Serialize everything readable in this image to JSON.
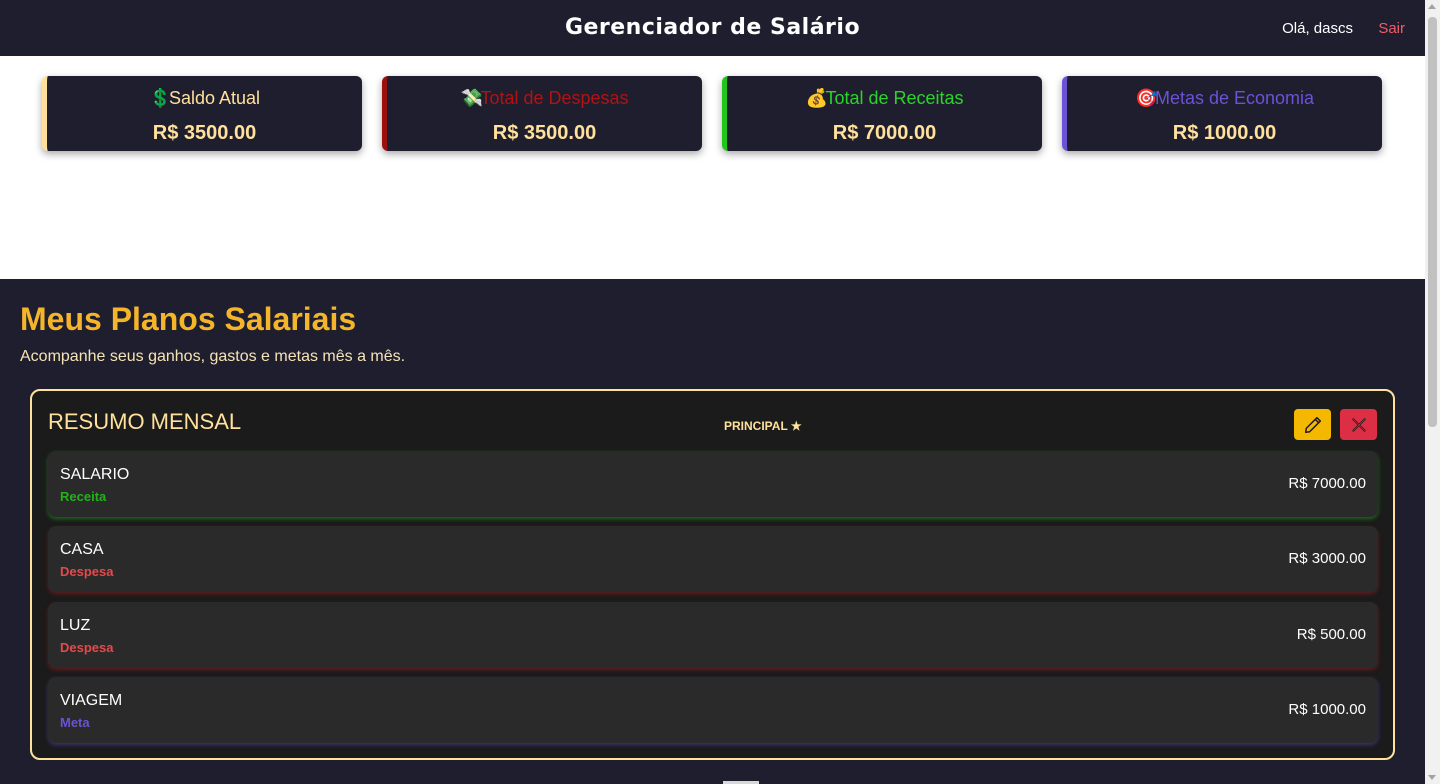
{
  "header": {
    "title": "Gerenciador de Salário",
    "greeting": "Olá, dascs",
    "logout_label": "Sair"
  },
  "summary_cards": [
    {
      "icon": "dollar-icon",
      "glyph": "💲",
      "label": "Saldo Atual",
      "value": "R$ 3500.00",
      "accent": "#ffe19c",
      "label_color": "#ffe19c"
    },
    {
      "icon": "money-with-wings-icon",
      "glyph": "💸",
      "label": "Total de Despesas",
      "value": "R$ 3500.00",
      "accent": "#9c0f0f",
      "label_color": "#b31212"
    },
    {
      "icon": "money-bag-icon",
      "glyph": "💰",
      "label": "Total de Receitas",
      "value": "R$ 7000.00",
      "accent": "#22c51a",
      "label_color": "#2bd42a"
    },
    {
      "icon": "target-icon",
      "glyph": "🎯",
      "label": "Metas de Economia",
      "value": "R$ 1000.00",
      "accent": "#6b52d6",
      "label_color": "#6b52d6"
    }
  ],
  "main": {
    "heading": "Meus Planos Salariais",
    "subtitle": "Acompanhe seus ganhos, gastos e metas mês a mês."
  },
  "plan": {
    "title": "RESUMO MENSAL",
    "badge": "PRINCIPAL ★",
    "edit_icon": "pencil-icon",
    "delete_icon": "close-icon",
    "items": [
      {
        "name": "SALARIO",
        "type": "Receita",
        "amount": "R$ 7000.00",
        "type_color": "#24b01b",
        "glow": "rgba(34,170,26,0.55)"
      },
      {
        "name": "CASA",
        "type": "Despesa",
        "amount": "R$ 3000.00",
        "type_color": "#e24b4b",
        "glow": "rgba(140,30,30,0.6)"
      },
      {
        "name": "LUZ",
        "type": "Despesa",
        "amount": "R$ 500.00",
        "type_color": "#e24b4b",
        "glow": "rgba(140,30,30,0.6)"
      },
      {
        "name": "VIAGEM",
        "type": "Meta",
        "amount": "R$ 1000.00",
        "type_color": "#6b52d6",
        "glow": "rgba(90,70,190,0.55)"
      }
    ]
  },
  "colors": {
    "dark_bg": "#1f1e2e",
    "gold": "#f4b52a",
    "cream": "#ffe19c"
  }
}
